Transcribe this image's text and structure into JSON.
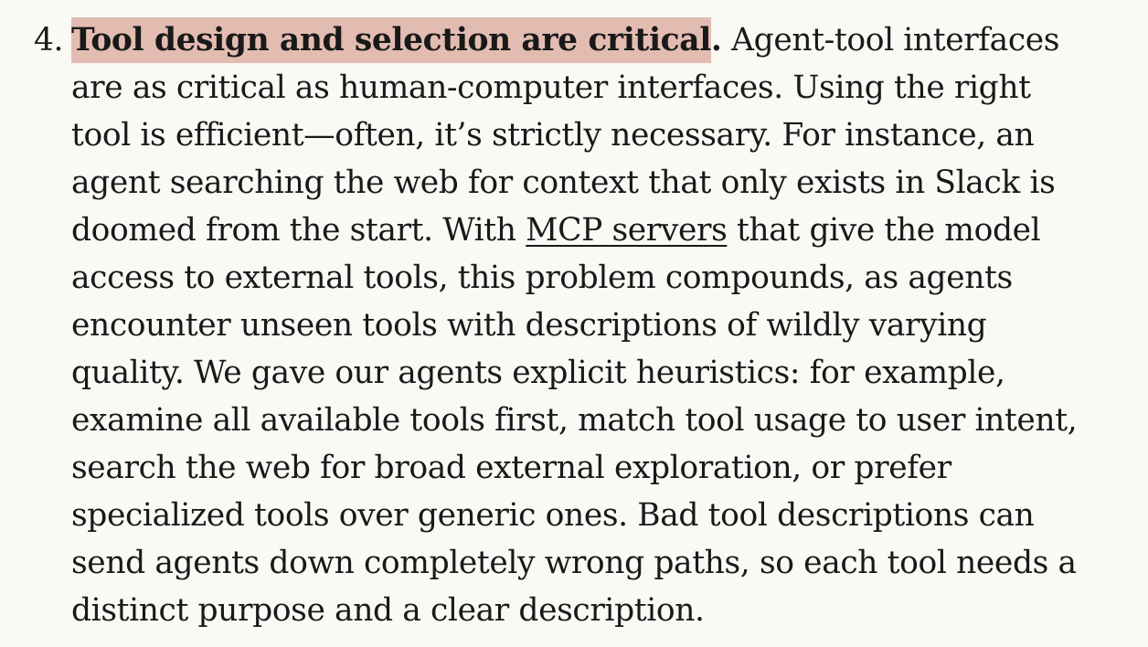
{
  "article": {
    "list_item": {
      "marker": "4.",
      "bold_heading": "Tool design and selection are critical",
      "heading_period": ".",
      "body_part1": " Agent-tool interfaces are as critical as human-computer interfaces. Using the right tool is efficient—often, it’s strictly necessary. For instance, an agent searching the web for context that only exists in Slack is doomed from the start. With ",
      "link_text": "MCP servers",
      "body_part2": " that give the model access to external tools, this problem compounds, as agents encounter unseen tools with descriptions of wildly varying quality. We gave our agents explicit heuristics: for example, examine all available tools first, match tool usage to user intent, search the web for broad external exploration, or prefer specialized tools over generic ones. Bad tool descriptions can send agents down completely wrong paths, so each tool needs a distinct purpose and a clear description."
    },
    "colors": {
      "background": "#faf9f5",
      "text": "#191919",
      "highlight": "#e3bcb1"
    }
  }
}
